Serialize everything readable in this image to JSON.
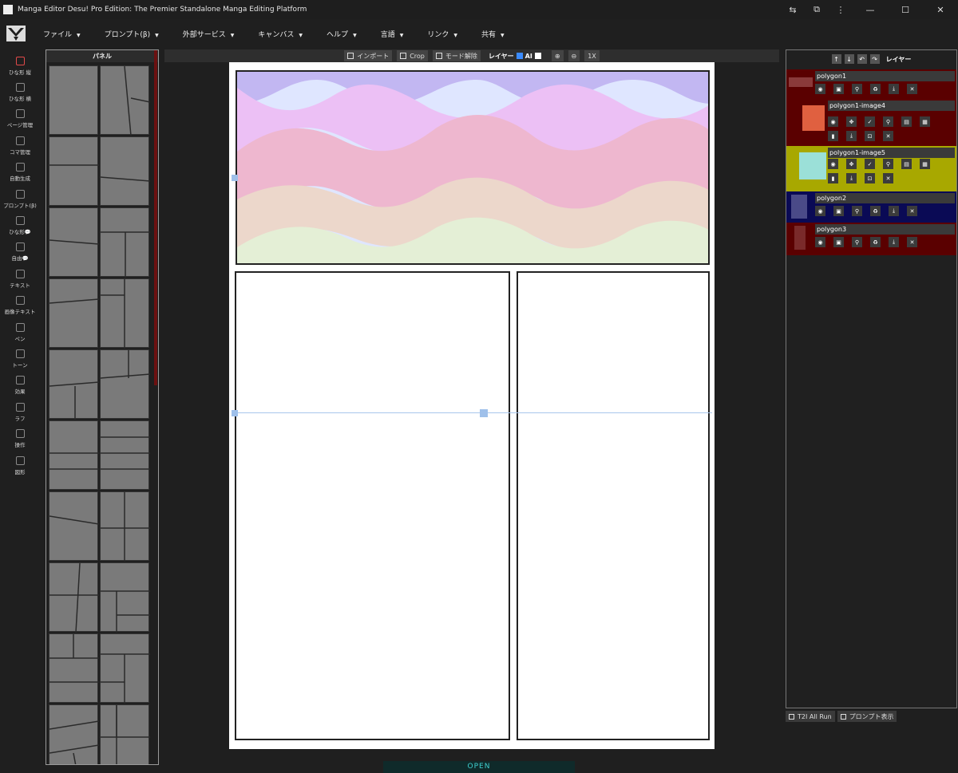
{
  "app": {
    "title": "Manga Editor Desu! Pro Edition: The Premier Standalone Manga Editing Platform"
  },
  "menu": [
    "ファイル",
    "プロンプト(β)",
    "外部サービス",
    "キャンバス",
    "ヘルプ",
    "言語",
    "リンク",
    "共有"
  ],
  "tools": [
    {
      "label": "ひな形 縦",
      "icon": "portrait-template-icon",
      "selected": true
    },
    {
      "label": "ひな形 横",
      "icon": "landscape-template-icon"
    },
    {
      "label": "ページ管理",
      "icon": "page-manage-icon"
    },
    {
      "label": "コマ管理",
      "icon": "panel-manage-icon"
    },
    {
      "label": "自動生成",
      "icon": "robot-icon"
    },
    {
      "label": "プロンプト(β)",
      "icon": "prompt-icon"
    },
    {
      "label": "ひな形💬",
      "icon": "speech-template-icon"
    },
    {
      "label": "自由💬",
      "icon": "speech-free-icon"
    },
    {
      "label": "テキスト",
      "icon": "text-icon"
    },
    {
      "label": "画像テキスト",
      "icon": "image-text-icon"
    },
    {
      "label": "ペン",
      "icon": "pen-icon"
    },
    {
      "label": "トーン",
      "icon": "tone-icon"
    },
    {
      "label": "効果",
      "icon": "effect-icon"
    },
    {
      "label": "ラフ",
      "icon": "rough-icon"
    },
    {
      "label": "操作",
      "icon": "gamepad-icon"
    },
    {
      "label": "図形",
      "icon": "shape-icon"
    }
  ],
  "panel": {
    "title": "パネル"
  },
  "toolbar": {
    "import": "インポート",
    "crop": "Crop",
    "mode_off": "モード解除",
    "layer": "レイヤー",
    "ai": "AI",
    "layer_checked": true,
    "ai_checked": false,
    "zoom_in": "zoom-in-icon",
    "zoom_out": "zoom-out-icon",
    "reset": "1X"
  },
  "layers_panel": {
    "title": "レイヤー",
    "layers": [
      {
        "name": "polygon1",
        "color": "#5a0000"
      },
      {
        "name": "polygon1-image4",
        "color": "#5a0000"
      },
      {
        "name": "polygon1-image5",
        "color": "#a8a800"
      },
      {
        "name": "polygon2",
        "color": "#0a0a55"
      },
      {
        "name": "polygon3",
        "color": "#5a0000"
      }
    ]
  },
  "bottom": {
    "t2i": "T2I All Run",
    "prompt": "プロンプト表示"
  },
  "open_label": "OPEN"
}
